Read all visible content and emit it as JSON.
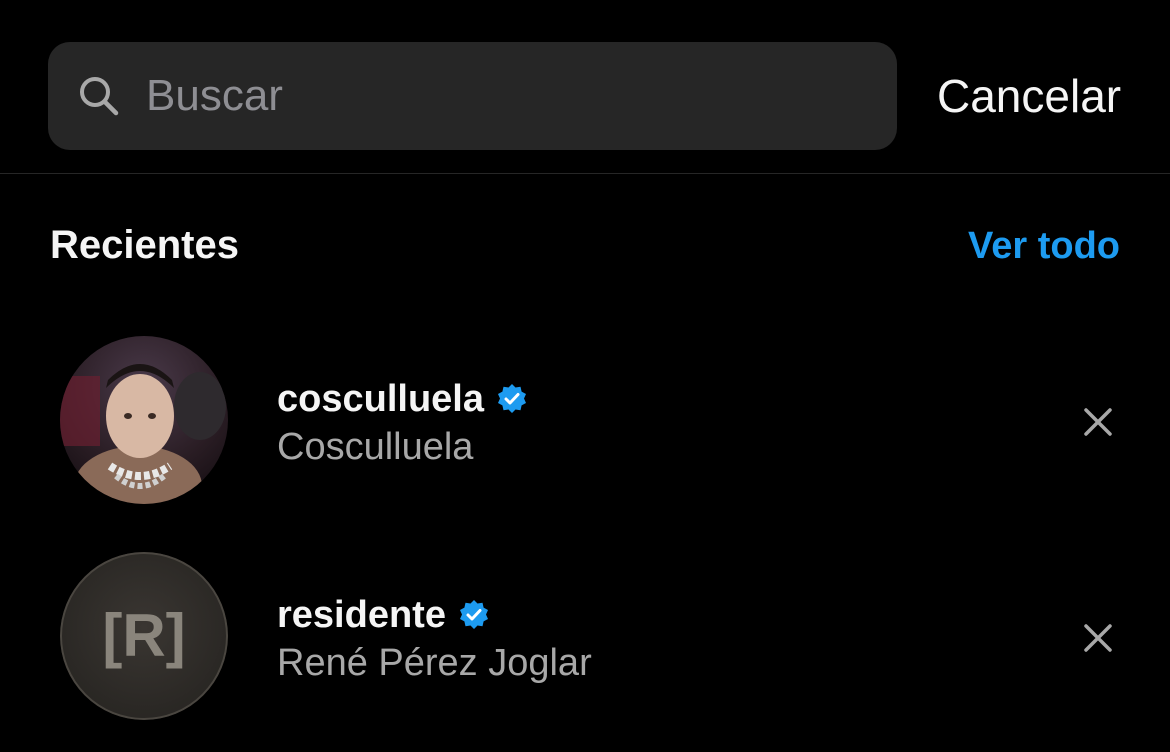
{
  "search": {
    "placeholder": "Buscar",
    "value": "",
    "icon": "search-icon"
  },
  "header": {
    "cancel_label": "Cancelar"
  },
  "recents": {
    "title": "Recientes",
    "see_all_label": "Ver todo",
    "items": [
      {
        "username": "cosculluela",
        "full_name": "Cosculluela",
        "verified": true,
        "avatar": "profile-photo"
      },
      {
        "username": "residente",
        "full_name": "René Pérez Joglar",
        "verified": true,
        "avatar": "[R]"
      }
    ]
  },
  "colors": {
    "background": "#000000",
    "search_bg": "#262626",
    "accent": "#1d9bf0",
    "verified": "#1d9bf0",
    "secondary_text": "#a8a8a8"
  }
}
